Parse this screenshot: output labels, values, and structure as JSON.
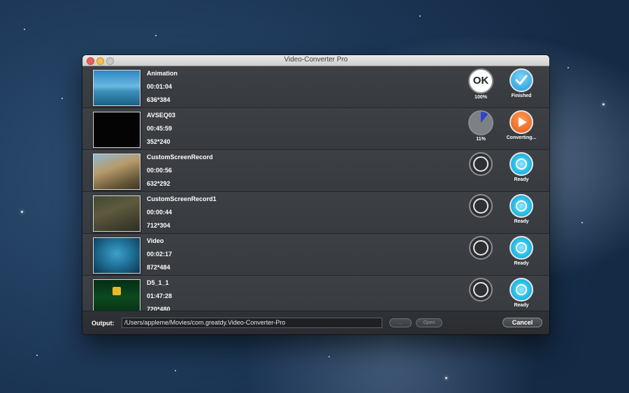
{
  "window": {
    "title": "Video-Converter Pro"
  },
  "files": [
    {
      "name": "Animation",
      "duration": "00:01:04",
      "resolution": "636*384",
      "progress_label": "100%",
      "progress_state": "ok",
      "progress_badge": "OK",
      "status_label": "Finished",
      "status_state": "finished",
      "thumb": "anim"
    },
    {
      "name": "AVSEQ03",
      "duration": "00:45:59",
      "resolution": "352*240",
      "progress_label": "11%",
      "progress_state": "pie",
      "progress_fraction": 0.11,
      "status_label": "Converting...",
      "status_state": "converting",
      "thumb": "avs"
    },
    {
      "name": "CustomScreenRecord",
      "duration": "00:00:56",
      "resolution": "632*292",
      "progress_label": "",
      "progress_state": "idle",
      "status_label": "Ready",
      "status_state": "ready",
      "thumb": "csr"
    },
    {
      "name": "CustomScreenRecord1",
      "duration": "00:00:44",
      "resolution": "712*304",
      "progress_label": "",
      "progress_state": "idle",
      "status_label": "Ready",
      "status_state": "ready",
      "thumb": "csr1"
    },
    {
      "name": "Video",
      "duration": "00:02:17",
      "resolution": "872*484",
      "progress_label": "",
      "progress_state": "idle",
      "status_label": "Ready",
      "status_state": "ready",
      "thumb": "video"
    },
    {
      "name": "D5_1_1",
      "duration": "01:47:28",
      "resolution": "720*480",
      "progress_label": "",
      "progress_state": "idle",
      "status_label": "Ready",
      "status_state": "ready",
      "thumb": "d5"
    }
  ],
  "bottom": {
    "output_label": "Output:",
    "output_path": "/Users/appleme/Movies/com.greatdy.Video-Converter-Pro",
    "browse_label": "...",
    "open_label": "Open",
    "cancel_label": "Cancel"
  }
}
